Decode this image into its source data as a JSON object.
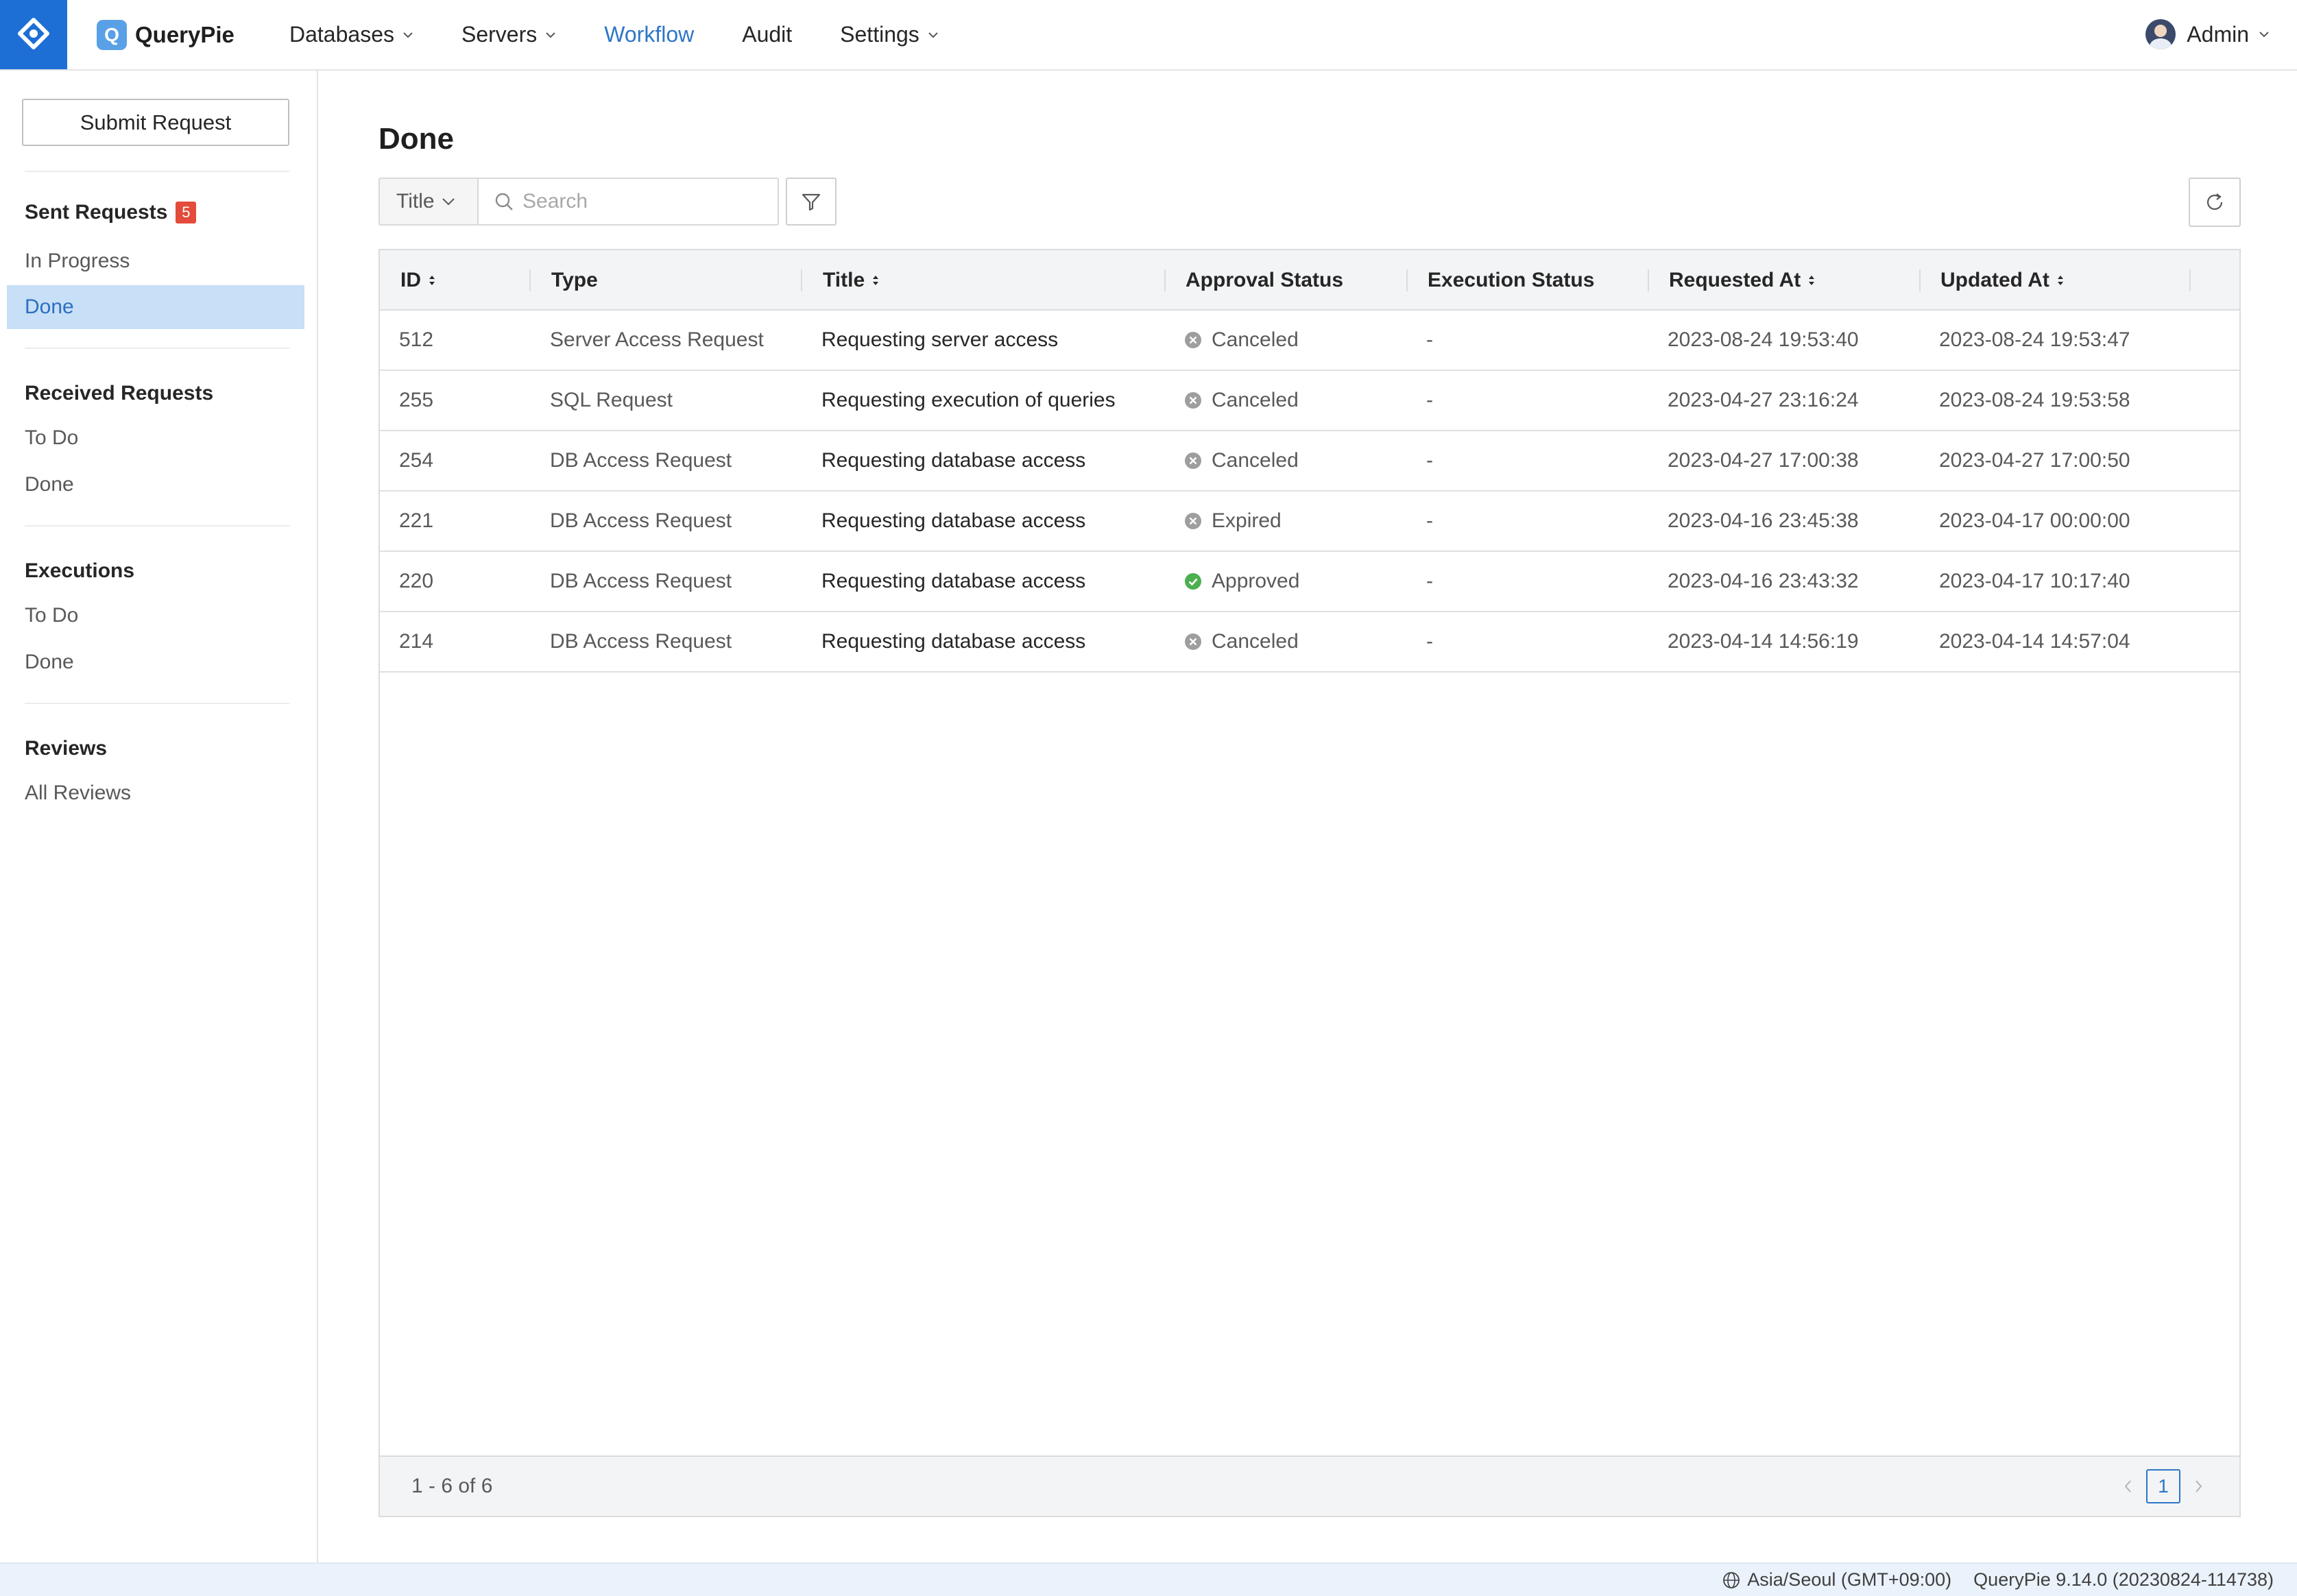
{
  "brand": {
    "letter": "Q",
    "name": "QueryPie"
  },
  "nav": [
    {
      "label": "Databases",
      "has_menu": true,
      "active": false
    },
    {
      "label": "Servers",
      "has_menu": true,
      "active": false
    },
    {
      "label": "Workflow",
      "has_menu": false,
      "active": true
    },
    {
      "label": "Audit",
      "has_menu": false,
      "active": false
    },
    {
      "label": "Settings",
      "has_menu": true,
      "active": false
    }
  ],
  "user": {
    "name": "Admin"
  },
  "sidebar": {
    "submit_label": "Submit Request",
    "sent": {
      "heading": "Sent Requests",
      "badge": "5",
      "items": [
        "In Progress",
        "Done"
      ]
    },
    "received": {
      "heading": "Received Requests",
      "items": [
        "To Do",
        "Done"
      ]
    },
    "executions": {
      "heading": "Executions",
      "items": [
        "To Do",
        "Done"
      ]
    },
    "reviews": {
      "heading": "Reviews",
      "items": [
        "All Reviews"
      ]
    },
    "active_item": "sent.Done"
  },
  "page": {
    "title": "Done"
  },
  "search": {
    "field": "Title",
    "placeholder": "Search",
    "value": ""
  },
  "table": {
    "columns": [
      {
        "label": "ID",
        "sortable": true
      },
      {
        "label": "Type",
        "sortable": false
      },
      {
        "label": "Title",
        "sortable": true
      },
      {
        "label": "Approval Status",
        "sortable": false
      },
      {
        "label": "Execution Status",
        "sortable": false
      },
      {
        "label": "Requested At",
        "sortable": true
      },
      {
        "label": "Updated At",
        "sortable": true
      }
    ],
    "rows": [
      {
        "id": "512",
        "type": "Server Access Request",
        "title": "Requesting server access",
        "approval": "Canceled",
        "approval_kind": "canceled",
        "execution": "-",
        "requested_at": "2023-08-24 19:53:40",
        "updated_at": "2023-08-24 19:53:47"
      },
      {
        "id": "255",
        "type": "SQL Request",
        "title": "Requesting execution of queries",
        "approval": "Canceled",
        "approval_kind": "canceled",
        "execution": "-",
        "requested_at": "2023-04-27 23:16:24",
        "updated_at": "2023-08-24 19:53:58"
      },
      {
        "id": "254",
        "type": "DB Access Request",
        "title": "Requesting database access",
        "approval": "Canceled",
        "approval_kind": "canceled",
        "execution": "-",
        "requested_at": "2023-04-27 17:00:38",
        "updated_at": "2023-04-27 17:00:50"
      },
      {
        "id": "221",
        "type": "DB Access Request",
        "title": "Requesting database access",
        "approval": "Expired",
        "approval_kind": "expired",
        "execution": "-",
        "requested_at": "2023-04-16 23:45:38",
        "updated_at": "2023-04-17 00:00:00"
      },
      {
        "id": "220",
        "type": "DB Access Request",
        "title": "Requesting database access",
        "approval": "Approved",
        "approval_kind": "approved",
        "execution": "-",
        "requested_at": "2023-04-16 23:43:32",
        "updated_at": "2023-04-17 10:17:40"
      },
      {
        "id": "214",
        "type": "DB Access Request",
        "title": "Requesting database access",
        "approval": "Canceled",
        "approval_kind": "canceled",
        "execution": "-",
        "requested_at": "2023-04-14 14:56:19",
        "updated_at": "2023-04-14 14:57:04"
      }
    ],
    "range_text": "1 - 6 of 6",
    "current_page": "1"
  },
  "statusbar": {
    "timezone": "Asia/Seoul (GMT+09:00)",
    "version": "QueryPie 9.14.0 (20230824-114738)"
  },
  "colors": {
    "accent": "#2e76c8",
    "logo_bg": "#1d6fd6",
    "badge": "#e34b3b",
    "approved": "#4caf50",
    "canceled": "#9e9e9e",
    "active_bg": "#c7dff7"
  }
}
